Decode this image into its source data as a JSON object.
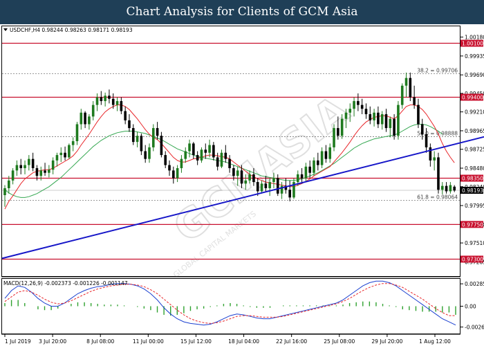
{
  "header": {
    "title": "Chart Analysis for Clients of GCM Asia"
  },
  "watermark": {
    "text": "GCMASIA",
    "subtext": "GLOBAL CAPITAL MARKETS"
  },
  "colors": {
    "header_bg": "#1f3f57",
    "bull": "#1e7a1e",
    "bear": "#000000",
    "ma_fast": "#e8262a",
    "ma_slow": "#36a852",
    "trendline": "#1616c8",
    "resistance": "#c8102e",
    "fib": "#777777",
    "macd_line": "#1a3fd0",
    "macd_signal": "#e8262a",
    "macd_hist": "#2ea12e"
  },
  "chart_data": [
    {
      "type": "candlestick",
      "symbol": "USDCHF,H4",
      "ohlc_info": "USDCHF,H4  0.98244 0.98263 0.98171 0.98193",
      "ylim": [
        0.9708,
        1.0032
      ],
      "price_ticks": [
        "1.00180",
        "0.99935",
        "0.99690",
        "0.99450",
        "0.99210",
        "0.98965",
        "0.98725",
        "0.98480",
        "0.98240",
        "0.97995",
        "0.97750",
        "0.97510",
        "0.97265"
      ],
      "x_labels": [
        "1 Jul 2019",
        "3 Jul 20:00",
        "8 Jul 08:00",
        "11 Jul 00:00",
        "15 Jul 12:00",
        "18 Jul 04:00",
        "22 Jul 16:00",
        "25 Jul 08:00",
        "29 Jul 20:00",
        "1 Aug 12:00"
      ],
      "horizontal_levels": [
        {
          "label": "1.00100",
          "value": 1.001
        },
        {
          "label": "0.99400",
          "value": 0.994
        },
        {
          "label": "0.98350",
          "value": 0.9835
        },
        {
          "label": "0.97750",
          "value": 0.9775
        },
        {
          "label": "0.97300",
          "value": 0.973
        }
      ],
      "fib_levels": [
        {
          "label": "38.2 = 0.99706",
          "value": 0.99706
        },
        {
          "label": "50.0 = 0.98888",
          "value": 0.98888
        },
        {
          "label": "61.8 = 0.98064",
          "value": 0.98064
        }
      ],
      "current_price": {
        "label": "0.98193",
        "value": 0.98193
      },
      "trendline": [
        {
          "bar": 0,
          "value": 0.9731
        },
        {
          "bar": 123,
          "value": 0.98934
        }
      ],
      "candles": [
        [
          0.9813,
          0.9826,
          0.9798,
          0.9822
        ],
        [
          0.9822,
          0.9838,
          0.9815,
          0.9832
        ],
        [
          0.9832,
          0.9848,
          0.9827,
          0.9845
        ],
        [
          0.9845,
          0.9858,
          0.9838,
          0.9852
        ],
        [
          0.9852,
          0.986,
          0.984,
          0.9848
        ],
        [
          0.9848,
          0.9858,
          0.984,
          0.9852
        ],
        [
          0.9852,
          0.9865,
          0.9845,
          0.986
        ],
        [
          0.986,
          0.9868,
          0.9844,
          0.9848
        ],
        [
          0.9848,
          0.9852,
          0.9832,
          0.9838
        ],
        [
          0.9838,
          0.985,
          0.9832,
          0.9845
        ],
        [
          0.9845,
          0.9855,
          0.9838,
          0.9842
        ],
        [
          0.9842,
          0.9852,
          0.9836,
          0.9846
        ],
        [
          0.9846,
          0.9862,
          0.984,
          0.9858
        ],
        [
          0.9858,
          0.9868,
          0.985,
          0.9865
        ],
        [
          0.9865,
          0.9875,
          0.9856,
          0.9868
        ],
        [
          0.9868,
          0.9876,
          0.9858,
          0.9862
        ],
        [
          0.9862,
          0.988,
          0.986,
          0.9878
        ],
        [
          0.9878,
          0.9888,
          0.987,
          0.9883
        ],
        [
          0.9883,
          0.9908,
          0.9878,
          0.9905
        ],
        [
          0.9905,
          0.9925,
          0.9898,
          0.992
        ],
        [
          0.992,
          0.9922,
          0.99,
          0.9905
        ],
        [
          0.9905,
          0.9918,
          0.9898,
          0.9915
        ],
        [
          0.9915,
          0.9935,
          0.991,
          0.993
        ],
        [
          0.993,
          0.9945,
          0.9922,
          0.994
        ],
        [
          0.994,
          0.9948,
          0.993,
          0.9935
        ],
        [
          0.9935,
          0.9946,
          0.9928,
          0.9942
        ],
        [
          0.9942,
          0.995,
          0.9932,
          0.9938
        ],
        [
          0.9938,
          0.9945,
          0.9925,
          0.993
        ],
        [
          0.993,
          0.994,
          0.9922,
          0.9935
        ],
        [
          0.9935,
          0.994,
          0.9918,
          0.9922
        ],
        [
          0.9922,
          0.9928,
          0.9905,
          0.991
        ],
        [
          0.991,
          0.9918,
          0.9895,
          0.99
        ],
        [
          0.99,
          0.9905,
          0.9878,
          0.9882
        ],
        [
          0.9882,
          0.9895,
          0.9875,
          0.989
        ],
        [
          0.989,
          0.9893,
          0.9865,
          0.987
        ],
        [
          0.987,
          0.9878,
          0.9855,
          0.986
        ],
        [
          0.986,
          0.988,
          0.9855,
          0.9875
        ],
        [
          0.9875,
          0.9905,
          0.987,
          0.99
        ],
        [
          0.99,
          0.9908,
          0.9885,
          0.989
        ],
        [
          0.989,
          0.9895,
          0.9862,
          0.9865
        ],
        [
          0.9865,
          0.987,
          0.9848,
          0.9852
        ],
        [
          0.9852,
          0.9858,
          0.9838,
          0.9845
        ],
        [
          0.9845,
          0.985,
          0.9828,
          0.9835
        ],
        [
          0.9835,
          0.9852,
          0.983,
          0.9848
        ],
        [
          0.9848,
          0.9865,
          0.9842,
          0.986
        ],
        [
          0.986,
          0.9875,
          0.9855,
          0.987
        ],
        [
          0.987,
          0.9885,
          0.9862,
          0.988
        ],
        [
          0.988,
          0.9882,
          0.986,
          0.9865
        ],
        [
          0.9865,
          0.987,
          0.9852,
          0.9858
        ],
        [
          0.9858,
          0.9875,
          0.9855,
          0.9872
        ],
        [
          0.9872,
          0.988,
          0.986,
          0.9868
        ],
        [
          0.9868,
          0.9885,
          0.9862,
          0.9878
        ],
        [
          0.9878,
          0.9882,
          0.9858,
          0.9862
        ],
        [
          0.9862,
          0.9868,
          0.9845,
          0.985
        ],
        [
          0.985,
          0.9872,
          0.9848,
          0.9868
        ],
        [
          0.9868,
          0.9878,
          0.9855,
          0.986
        ],
        [
          0.986,
          0.9865,
          0.9842,
          0.9848
        ],
        [
          0.9848,
          0.9852,
          0.9832,
          0.9838
        ],
        [
          0.9838,
          0.985,
          0.9825,
          0.9845
        ],
        [
          0.9845,
          0.9852,
          0.9822,
          0.9828
        ],
        [
          0.9828,
          0.984,
          0.982,
          0.9832
        ],
        [
          0.9832,
          0.9845,
          0.9828,
          0.984
        ],
        [
          0.984,
          0.9848,
          0.9825,
          0.983
        ],
        [
          0.983,
          0.9835,
          0.9812,
          0.9818
        ],
        [
          0.9818,
          0.9832,
          0.9815,
          0.9828
        ],
        [
          0.9828,
          0.9838,
          0.9818,
          0.9822
        ],
        [
          0.9822,
          0.9835,
          0.9812,
          0.983
        ],
        [
          0.983,
          0.9842,
          0.9822,
          0.9835
        ],
        [
          0.9835,
          0.984,
          0.9812,
          0.9815
        ],
        [
          0.9815,
          0.983,
          0.9808,
          0.9825
        ],
        [
          0.9825,
          0.9835,
          0.9815,
          0.982
        ],
        [
          0.982,
          0.9832,
          0.9805,
          0.981
        ],
        [
          0.981,
          0.9835,
          0.9808,
          0.983
        ],
        [
          0.983,
          0.9845,
          0.9825,
          0.984
        ],
        [
          0.984,
          0.9848,
          0.9828,
          0.9835
        ],
        [
          0.9835,
          0.9855,
          0.983,
          0.985
        ],
        [
          0.985,
          0.9858,
          0.9835,
          0.9842
        ],
        [
          0.9842,
          0.9862,
          0.9838,
          0.9858
        ],
        [
          0.9858,
          0.9868,
          0.9845,
          0.9852
        ],
        [
          0.9852,
          0.9875,
          0.9848,
          0.987
        ],
        [
          0.987,
          0.9878,
          0.9855,
          0.986
        ],
        [
          0.986,
          0.988,
          0.9855,
          0.9875
        ],
        [
          0.9875,
          0.9905,
          0.987,
          0.99
        ],
        [
          0.99,
          0.9915,
          0.9885,
          0.989
        ],
        [
          0.989,
          0.9918,
          0.9886,
          0.9912
        ],
        [
          0.9912,
          0.9925,
          0.99,
          0.992
        ],
        [
          0.992,
          0.9932,
          0.9908,
          0.9925
        ],
        [
          0.9925,
          0.994,
          0.9915,
          0.9935
        ],
        [
          0.9935,
          0.9945,
          0.9922,
          0.993
        ],
        [
          0.993,
          0.9938,
          0.9918,
          0.9925
        ],
        [
          0.9925,
          0.9932,
          0.9912,
          0.9918
        ],
        [
          0.9918,
          0.9928,
          0.9905,
          0.991
        ],
        [
          0.991,
          0.9925,
          0.9902,
          0.992
        ],
        [
          0.992,
          0.9928,
          0.99,
          0.9905
        ],
        [
          0.9905,
          0.9922,
          0.9898,
          0.9918
        ],
        [
          0.9918,
          0.9925,
          0.9895,
          0.99
        ],
        [
          0.99,
          0.9915,
          0.9888,
          0.9912
        ],
        [
          0.9912,
          0.9918,
          0.9885,
          0.989
        ],
        [
          0.989,
          0.9935,
          0.9885,
          0.993
        ],
        [
          0.993,
          0.9958,
          0.9925,
          0.9955
        ],
        [
          0.9955,
          0.9972,
          0.994,
          0.9965
        ],
        [
          0.9965,
          0.9972,
          0.9935,
          0.994
        ],
        [
          0.994,
          0.9955,
          0.9925,
          0.993
        ],
        [
          0.993,
          0.9938,
          0.99,
          0.9905
        ],
        [
          0.9905,
          0.9912,
          0.9885,
          0.9892
        ],
        [
          0.9892,
          0.99,
          0.9868,
          0.9875
        ],
        [
          0.9875,
          0.988,
          0.985,
          0.9858
        ],
        [
          0.9858,
          0.987,
          0.9845,
          0.9862
        ],
        [
          0.9862,
          0.9868,
          0.9815,
          0.982
        ],
        [
          0.982,
          0.983,
          0.9814,
          0.9825
        ],
        [
          0.9825,
          0.983,
          0.9815,
          0.9818
        ],
        [
          0.9818,
          0.983,
          0.9815,
          0.9826
        ],
        [
          0.9824,
          0.9826,
          0.9817,
          0.9819
        ]
      ],
      "ma_fast": [
        0.9795,
        0.9805,
        0.9812,
        0.982,
        0.9828,
        0.9834,
        0.9838,
        0.9842,
        0.9844,
        0.9845,
        0.9846,
        0.9846,
        0.9848,
        0.9851,
        0.9854,
        0.9857,
        0.986,
        0.9864,
        0.987,
        0.9878,
        0.9885,
        0.9892,
        0.99,
        0.9908,
        0.9915,
        0.9921,
        0.9925,
        0.9928,
        0.993,
        0.993,
        0.9928,
        0.9924,
        0.9918,
        0.9912,
        0.9905,
        0.9898,
        0.9892,
        0.9888,
        0.9885,
        0.988,
        0.9874,
        0.9868,
        0.9862,
        0.9858,
        0.9856,
        0.9856,
        0.9858,
        0.986,
        0.9861,
        0.9862,
        0.9864,
        0.9865,
        0.9865,
        0.9864,
        0.9863,
        0.9862,
        0.986,
        0.9856,
        0.9852,
        0.9848,
        0.9844,
        0.984,
        0.9837,
        0.9834,
        0.9832,
        0.983,
        0.9829,
        0.9828,
        0.9827,
        0.9826,
        0.9825,
        0.9824,
        0.9824,
        0.9826,
        0.9828,
        0.9831,
        0.9834,
        0.9838,
        0.9841,
        0.9844,
        0.9847,
        0.985,
        0.9856,
        0.9862,
        0.9868,
        0.9875,
        0.9882,
        0.989,
        0.9897,
        0.9903,
        0.9908,
        0.9911,
        0.9914,
        0.9915,
        0.9916,
        0.9916,
        0.9914,
        0.9912,
        0.9916,
        0.9922,
        0.9928,
        0.993,
        0.993,
        0.9928,
        0.9924,
        0.9918,
        0.991,
        0.9902,
        0.9892,
        0.988,
        0.987,
        0.9862,
        0.9855
      ],
      "ma_slow": [
        0.982,
        0.9816,
        0.9813,
        0.9811,
        0.981,
        0.981,
        0.9811,
        0.9813,
        0.9815,
        0.9818,
        0.9821,
        0.9824,
        0.9828,
        0.9832,
        0.9836,
        0.9841,
        0.9846,
        0.9851,
        0.9856,
        0.9861,
        0.9866,
        0.9871,
        0.9876,
        0.988,
        0.9884,
        0.9887,
        0.989,
        0.9892,
        0.9894,
        0.9895,
        0.9896,
        0.9896,
        0.9896,
        0.9895,
        0.9894,
        0.9893,
        0.9891,
        0.9889,
        0.9887,
        0.9885,
        0.9882,
        0.9879,
        0.9876,
        0.9873,
        0.9871,
        0.9869,
        0.9867,
        0.9865,
        0.9863,
        0.9862,
        0.9861,
        0.986,
        0.9859,
        0.9858,
        0.9857,
        0.9856,
        0.9854,
        0.9852,
        0.985,
        0.9848,
        0.9846,
        0.9844,
        0.9842,
        0.984,
        0.9838,
        0.9837,
        0.9836,
        0.9835,
        0.9834,
        0.9833,
        0.9832,
        0.9832,
        0.9832,
        0.9833,
        0.9834,
        0.9836,
        0.9838,
        0.984,
        0.9842,
        0.9845,
        0.9848,
        0.9851,
        0.9854,
        0.9858,
        0.9862,
        0.9866,
        0.987,
        0.9874,
        0.9877,
        0.988,
        0.9882,
        0.9884,
        0.9886,
        0.9887,
        0.9888,
        0.9889,
        0.989,
        0.9891,
        0.9893,
        0.9896,
        0.9899,
        0.9902,
        0.9904,
        0.9905,
        0.9905,
        0.9904,
        0.9902,
        0.9899,
        0.9896,
        0.9892
      ]
    },
    {
      "type": "line",
      "name": "MACD(12,26,9)",
      "label": "MACD(12,26,9) -0.002373 -0.001226 -0.001147",
      "ylim": [
        -0.0034,
        0.0034
      ],
      "ticks": [
        "0.002857",
        "0.00",
        "-0.002657"
      ],
      "macd": [
        0.001,
        0.002,
        0.0026,
        0.0024,
        0.0018,
        0.001,
        0.0004,
        0.0,
        0.0,
        0.0004,
        0.001,
        0.0016,
        0.002,
        0.0023,
        0.0025,
        0.0026,
        0.0028,
        0.0029,
        0.0029,
        0.0028,
        0.0026,
        0.0022,
        0.0016,
        0.0008,
        -0.0002,
        -0.001,
        -0.0016,
        -0.002,
        -0.0022,
        -0.0023,
        -0.0024,
        -0.0023,
        -0.002,
        -0.0016,
        -0.0012,
        -0.001,
        -0.0011,
        -0.0013,
        -0.0015,
        -0.0016,
        -0.0016,
        -0.0014,
        -0.0012,
        -0.001,
        -0.0008,
        -0.0006,
        -0.0004,
        -0.0002,
        0.0,
        0.0002,
        0.0004,
        0.0008,
        0.0014,
        0.002,
        0.0026,
        0.003,
        0.0032,
        0.0032,
        0.003,
        0.0026,
        0.002,
        0.0014,
        0.0008,
        0.0002,
        -0.0004,
        -0.001,
        -0.0016,
        -0.002,
        -0.0024
      ],
      "signal": [
        0.0006,
        0.0012,
        0.0018,
        0.002,
        0.0018,
        0.0014,
        0.0009,
        0.0005,
        0.0003,
        0.0004,
        0.0007,
        0.0011,
        0.0015,
        0.0019,
        0.0022,
        0.0024,
        0.0026,
        0.0027,
        0.0028,
        0.0028,
        0.0027,
        0.0025,
        0.0021,
        0.0016,
        0.0009,
        0.0002,
        -0.0005,
        -0.0011,
        -0.0016,
        -0.0019,
        -0.0021,
        -0.0022,
        -0.0021,
        -0.0019,
        -0.0016,
        -0.0013,
        -0.0012,
        -0.0012,
        -0.0013,
        -0.0014,
        -0.0014,
        -0.0014,
        -0.0013,
        -0.0011,
        -0.0009,
        -0.0007,
        -0.0005,
        -0.0003,
        -0.0001,
        0.0001,
        0.0003,
        0.0006,
        0.001,
        0.0015,
        0.002,
        0.0024,
        0.0027,
        0.0029,
        0.0029,
        0.0027,
        0.0024,
        0.0019,
        0.0014,
        0.0009,
        0.0003,
        -0.0003,
        -0.0008,
        -0.0012,
        -0.0012
      ],
      "histogram": [
        0.0004,
        0.0008,
        0.0008,
        0.0004,
        0.0,
        -0.0004,
        -0.0005,
        -0.0005,
        -0.0003,
        0.0,
        0.0003,
        0.0005,
        0.0005,
        0.0004,
        0.0003,
        0.0002,
        0.0002,
        0.0002,
        0.0001,
        0.0,
        -0.0001,
        -0.0003,
        -0.0005,
        -0.0008,
        -0.0011,
        -0.0012,
        -0.0011,
        -0.0009,
        -0.0006,
        -0.0004,
        -0.0003,
        -0.0001,
        0.0001,
        0.0003,
        0.0004,
        0.0003,
        0.0001,
        -0.0001,
        -0.0002,
        -0.0002,
        -0.0002,
        0.0,
        0.0001,
        0.0001,
        0.0001,
        0.0001,
        0.0001,
        0.0001,
        0.0001,
        0.0001,
        0.0001,
        0.0002,
        0.0004,
        0.0005,
        0.0006,
        0.0006,
        0.0005,
        0.0003,
        0.0001,
        -0.0001,
        -0.0004,
        -0.0005,
        -0.0006,
        -0.0007,
        -0.0007,
        -0.0007,
        -0.0008,
        -0.0008,
        -0.0011
      ]
    }
  ]
}
